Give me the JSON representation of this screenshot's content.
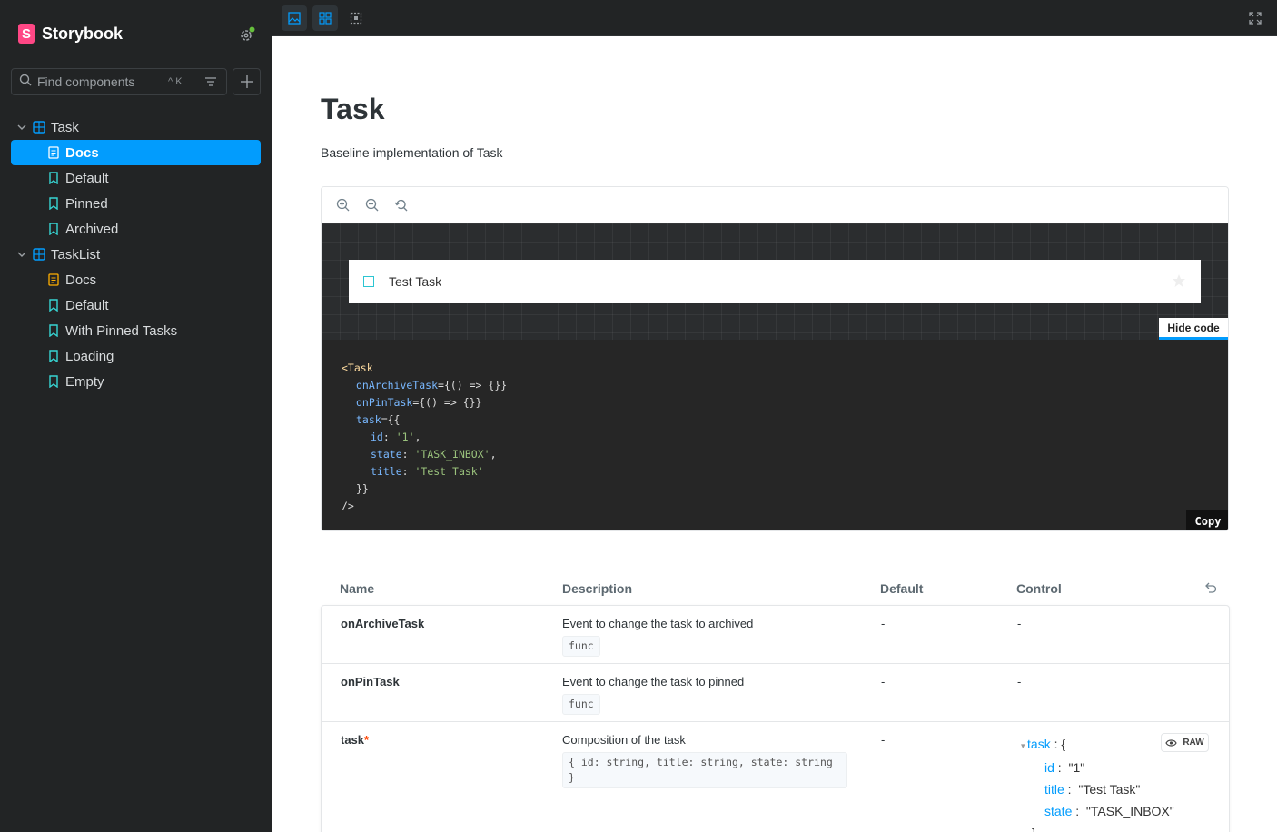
{
  "app": {
    "name": "Storybook",
    "logo_letter": "S"
  },
  "search": {
    "placeholder": "Find components",
    "shortcut": "^ K"
  },
  "tree": [
    {
      "type": "component",
      "label": "Task",
      "children": [
        {
          "type": "docs",
          "label": "Docs",
          "active": true
        },
        {
          "type": "story",
          "label": "Default"
        },
        {
          "type": "story",
          "label": "Pinned"
        },
        {
          "type": "story",
          "label": "Archived"
        }
      ]
    },
    {
      "type": "component",
      "label": "TaskList",
      "children": [
        {
          "type": "docs",
          "label": "Docs"
        },
        {
          "type": "story",
          "label": "Default"
        },
        {
          "type": "story",
          "label": "With Pinned Tasks"
        },
        {
          "type": "story",
          "label": "Loading"
        },
        {
          "type": "story",
          "label": "Empty"
        }
      ]
    }
  ],
  "docs": {
    "title": "Task",
    "subtitle": "Baseline implementation of Task",
    "preview_task_title": "Test Task",
    "hide_code_label": "Hide code",
    "copy_label": "Copy",
    "code": {
      "tag_open": "<Task",
      "attr1": "onArchiveTask",
      "val1": "={() => {}}",
      "attr2": "onPinTask",
      "val2": "={() => {}}",
      "attr3": "task",
      "val3": "={{",
      "k_id": "id",
      "v_id": "'1'",
      "k_state": "state",
      "v_state": "'TASK_INBOX'",
      "k_title": "title",
      "v_title": "'Test Task'",
      "close_obj": "}}",
      "tag_close": "/>"
    }
  },
  "props_table": {
    "headers": {
      "name": "Name",
      "description": "Description",
      "default": "Default",
      "control": "Control"
    },
    "rows": [
      {
        "name": "onArchiveTask",
        "required": false,
        "description": "Event to change the task to archived",
        "type": "func",
        "default": "-",
        "control": "-"
      },
      {
        "name": "onPinTask",
        "required": false,
        "description": "Event to change the task to pinned",
        "type": "func",
        "default": "-",
        "control": "-"
      },
      {
        "name": "task",
        "required": true,
        "description": "Composition of the task",
        "type": "{ id: string, title: string, state: string }",
        "default": "-",
        "control": ""
      }
    ],
    "required_marker": "*",
    "raw_label": "RAW",
    "json_control": {
      "root_key": "task",
      "open": "{",
      "id_key": "id",
      "id_val": "\"1\"",
      "title_key": "title",
      "title_val": "\"Test Task\"",
      "state_key": "state",
      "state_val": "\"TASK_INBOX\"",
      "close": "}"
    }
  },
  "colors": {
    "accent": "#029cfd",
    "brand": "#ff4785",
    "sidebar_bg": "#222425"
  }
}
